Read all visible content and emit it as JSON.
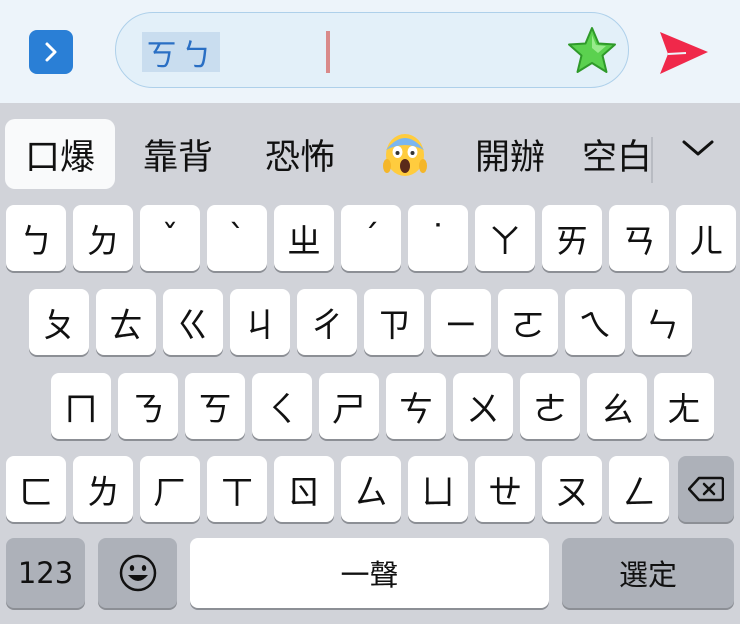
{
  "composer": {
    "composing_text": "ㄎㄅ",
    "sticker_icon": "green-star-icon",
    "send_icon": "send-arrow-icon",
    "expand_icon": "chevron-right-icon"
  },
  "candidates": {
    "items": [
      "口爆",
      "靠背",
      "恐怖",
      "😱",
      "開辦",
      "空白"
    ],
    "more_icon": "chevron-down-icon"
  },
  "keyboard": {
    "rows": [
      [
        "ㄅ",
        "ㄉ",
        "ˇ",
        "ˋ",
        "ㄓ",
        "ˊ",
        "˙",
        "ㄚ",
        "ㄞ",
        "ㄢ",
        "ㄦ"
      ],
      [
        "ㄆ",
        "ㄊ",
        "ㄍ",
        "ㄐ",
        "ㄔ",
        "ㄗ",
        "ㄧ",
        "ㄛ",
        "ㄟ",
        "ㄣ"
      ],
      [
        "ㄇ",
        "ㄋ",
        "ㄎ",
        "ㄑ",
        "ㄕ",
        "ㄘ",
        "ㄨ",
        "ㄜ",
        "ㄠ",
        "ㄤ"
      ],
      [
        "ㄈ",
        "ㄌ",
        "ㄏ",
        "ㄒ",
        "ㄖ",
        "ㄙ",
        "ㄩ",
        "ㄝ",
        "ㄡ",
        "ㄥ"
      ]
    ],
    "delete_icon": "backspace-icon",
    "numbers_label": "123",
    "emoji_icon": "emoji-face-icon",
    "space_label": "一聲",
    "select_label": "選定"
  },
  "colors": {
    "accent_blue": "#2a7fd6",
    "send_red": "#f0284a",
    "star_green": "#5bd14f"
  }
}
